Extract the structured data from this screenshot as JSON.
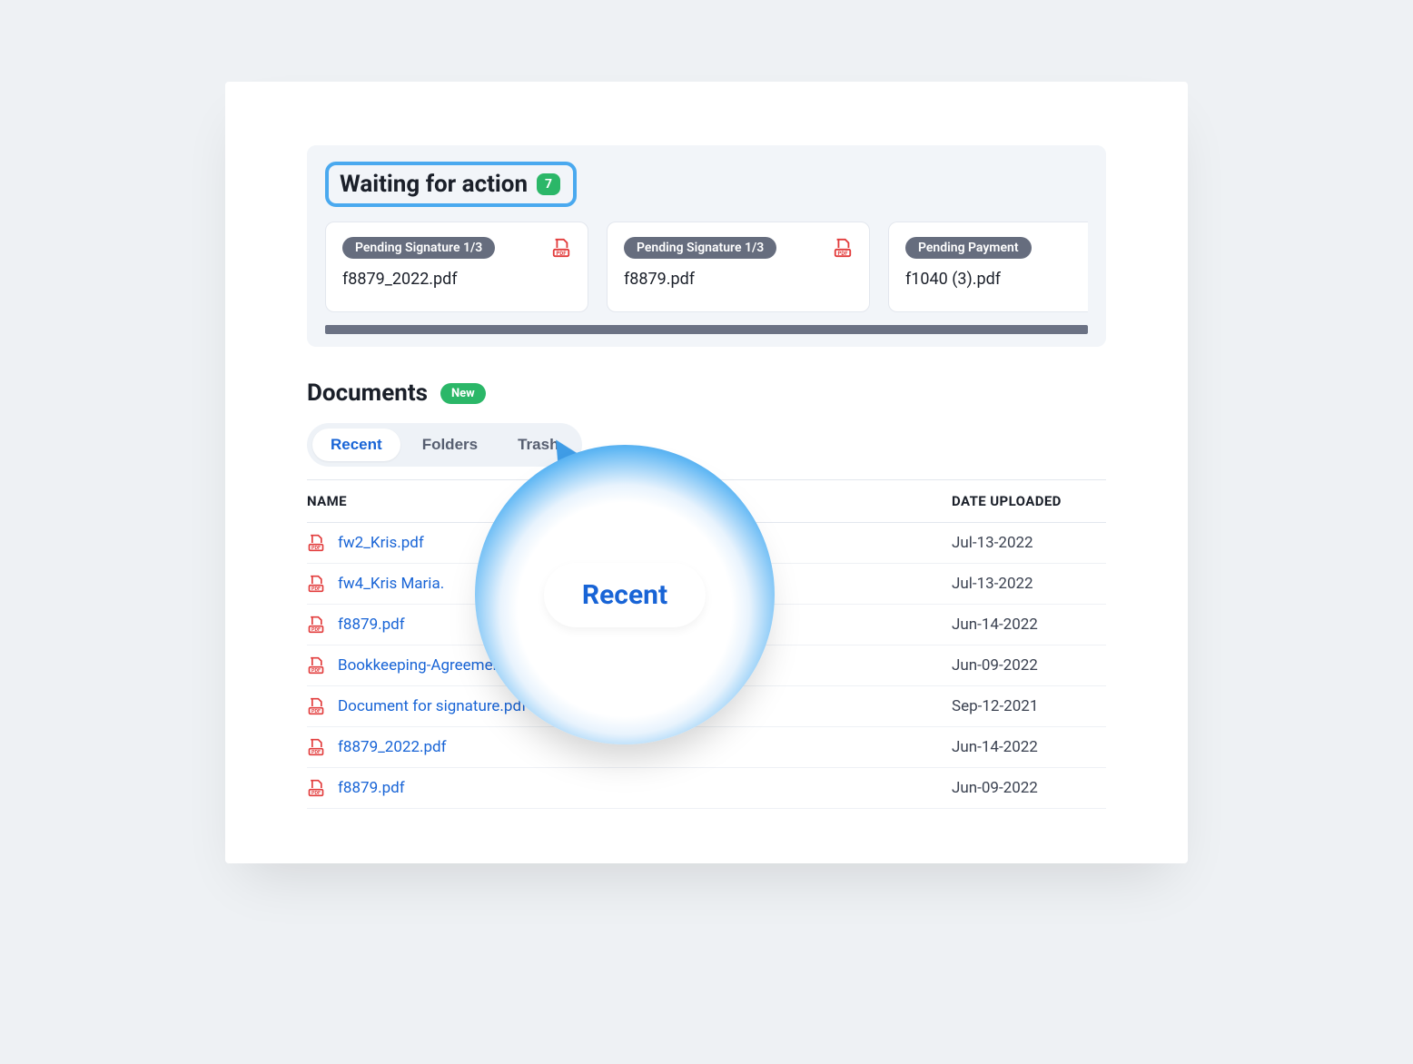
{
  "waiting": {
    "title": "Waiting for action",
    "count": "7",
    "cards": [
      {
        "status": "Pending Signature 1/3",
        "file": "f8879_2022.pdf"
      },
      {
        "status": "Pending Signature 1/3",
        "file": "f8879.pdf"
      },
      {
        "status": "Pending Payment",
        "file": "f1040 (3).pdf"
      }
    ]
  },
  "documents": {
    "title": "Documents",
    "new_label": "New",
    "tabs": {
      "recent": "Recent",
      "folders": "Folders",
      "trash": "Trash"
    },
    "magnifier_label": "Recent",
    "columns": {
      "name": "NAME",
      "date": "DATE UPLOADED"
    },
    "rows": [
      {
        "name": "fw2_Kris.pdf",
        "date": "Jul-13-2022"
      },
      {
        "name": "fw4_Kris Maria.",
        "date": "Jul-13-2022"
      },
      {
        "name": "f8879.pdf",
        "date": "Jun-14-2022"
      },
      {
        "name": "Bookkeeping-Agreement.pdf",
        "date": "Jun-09-2022"
      },
      {
        "name": "Document for signature.pdf",
        "date": "Sep-12-2021"
      },
      {
        "name": "f8879_2022.pdf",
        "date": "Jun-14-2022"
      },
      {
        "name": "f8879.pdf",
        "date": "Jun-09-2022"
      }
    ]
  }
}
